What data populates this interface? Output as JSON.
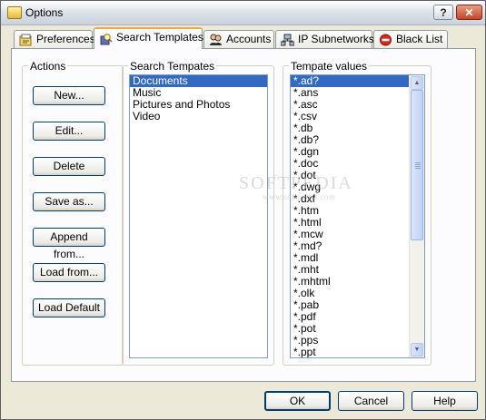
{
  "window": {
    "title": "Options",
    "help_btn": "?",
    "close_btn": "✕"
  },
  "tabs": [
    {
      "label": "Preferences"
    },
    {
      "label": "Search Templates"
    },
    {
      "label": "Accounts"
    },
    {
      "label": "IP Subnetworks"
    },
    {
      "label": "Black List"
    }
  ],
  "actions": {
    "label": "Actions",
    "buttons": [
      "New...",
      "Edit...",
      "Delete",
      "Save as...",
      "Append from...",
      "Load from...",
      "Load Default"
    ]
  },
  "templates": {
    "label": "Search Tempates",
    "items": [
      "Documents",
      "Music",
      "Pictures and Photos",
      "Video"
    ],
    "selected_index": 0
  },
  "values": {
    "label": "Tempate values",
    "items": [
      "*.ad?",
      "*.ans",
      "*.asc",
      "*.csv",
      "*.db",
      "*.db?",
      "*.dgn",
      "*.doc",
      "*.dot",
      "*.dwg",
      "*.dxf",
      "*.htm",
      "*.html",
      "*.mcw",
      "*.md?",
      "*.mdl",
      "*.mht",
      "*.mhtml",
      "*.olk",
      "*.pab",
      "*.pdf",
      "*.pot",
      "*.pps",
      "*.ppt"
    ],
    "selected_index": 0
  },
  "footer": {
    "ok": "OK",
    "cancel": "Cancel",
    "help": "Help"
  },
  "watermark": {
    "line1": "SOFTPEDIA",
    "line2": "www.softpedia.com"
  },
  "colors": {
    "selection": "#316ac5",
    "active_tab_accent": "#f1a93b",
    "close_button": "#c74524"
  }
}
